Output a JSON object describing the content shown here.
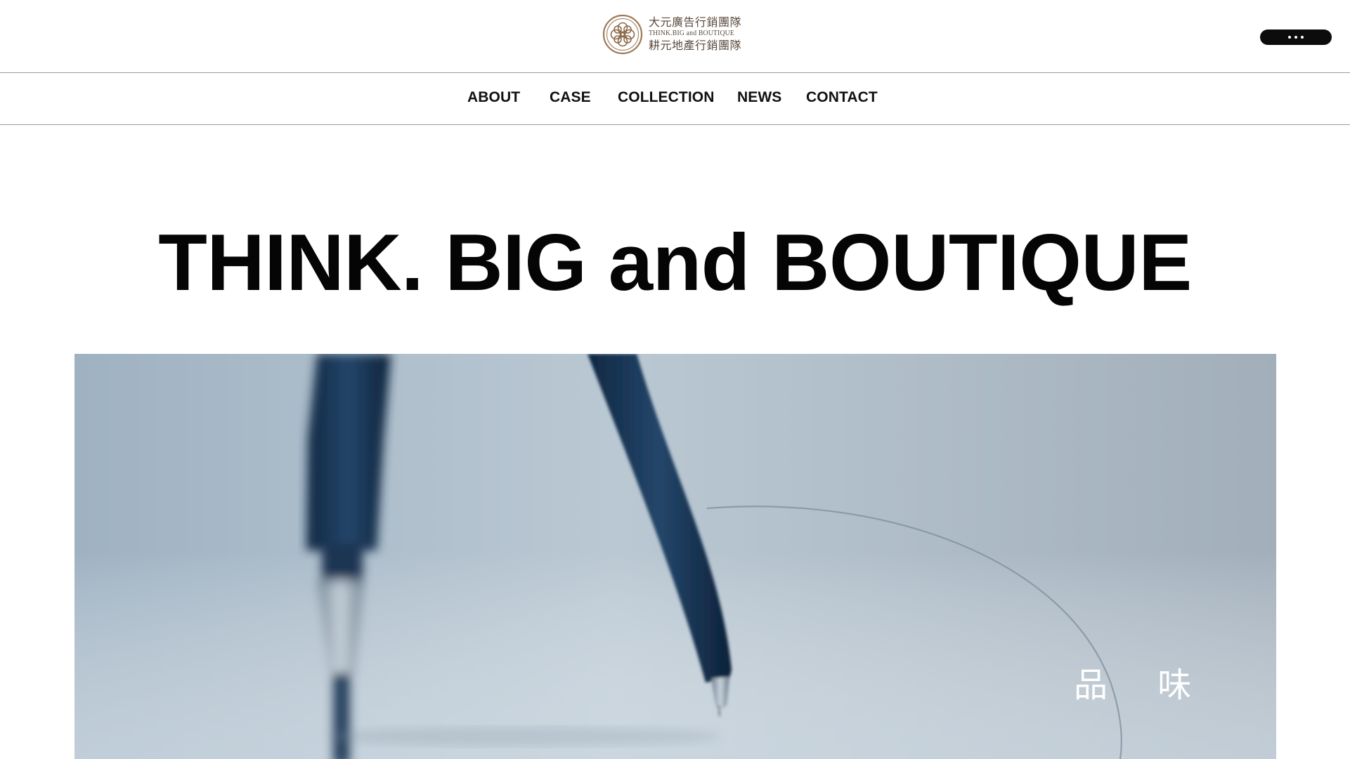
{
  "header": {
    "logo": {
      "line_zh_1": "大元廣告行銷團隊",
      "line_en": "THINK.BIG and BOUTIQUE",
      "line_zh_2": "耕元地產行銷團隊"
    },
    "menu_icon": "more-dots-icon"
  },
  "nav": {
    "items": [
      {
        "label": "ABOUT"
      },
      {
        "label": "CASE"
      },
      {
        "label": "COLLECTION"
      },
      {
        "label": "NEWS"
      },
      {
        "label": "CONTACT"
      }
    ]
  },
  "hero": {
    "title": "THINK. BIG and BOUTIQUE",
    "caption": "品 味"
  },
  "colors": {
    "logo_brown": "#5a4a3e",
    "menu_button": "#0c0c0c",
    "divider": "#9a9a9a",
    "compass_navy": "#13304f"
  }
}
